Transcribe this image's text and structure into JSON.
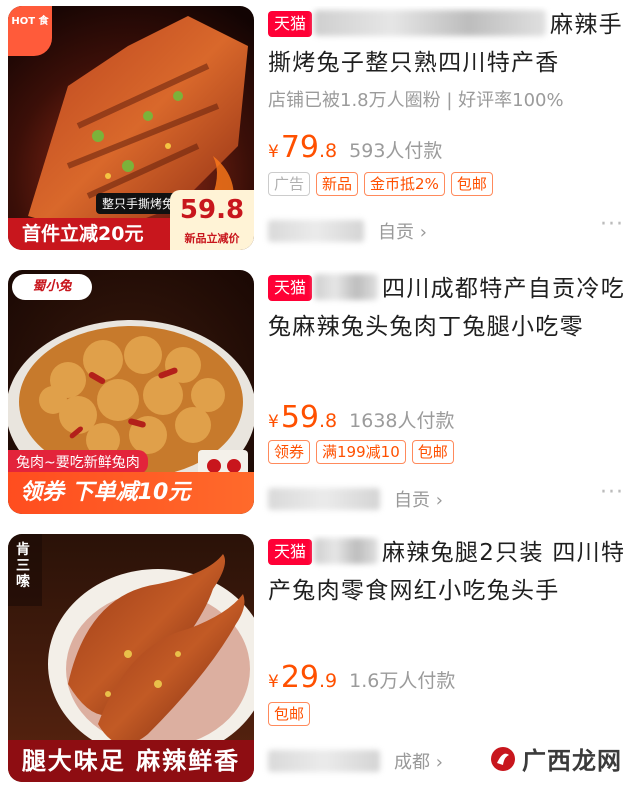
{
  "products": [
    {
      "tmall_badge": "天猫",
      "title_rest": "麻辣手撕烤兔子整只熟四川特产香",
      "subline": "店铺已被1.8万人圈粉 | 好评率100%",
      "currency": "¥",
      "price_int": "79",
      "price_dec": ".8",
      "paid_count": "593人付款",
      "tags": [
        "广告",
        "新品",
        "金币抵2%",
        "包邮"
      ],
      "shop_location": "自贡 ›",
      "more": "···",
      "image": {
        "logo_text": "HOT 食",
        "product_label": "整只手撕烤兔",
        "banner_text": "首件立减20元",
        "banner_price": "59.8",
        "banner_price_sub": "新品立减价"
      }
    },
    {
      "tmall_badge": "天猫",
      "title_rest": "四川成都特产自贡冷吃兔麻辣兔头兔肉丁兔腿小吃零",
      "currency": "¥",
      "price_int": "59",
      "price_dec": ".8",
      "paid_count": "1638人付款",
      "tags": [
        "领券",
        "满199减10",
        "包邮"
      ],
      "shop_location": "自贡 ›",
      "more": "···",
      "image": {
        "logo_text": "蜀小兔",
        "top_label": "兔肉~要吃新鲜兔肉",
        "banner_text": "领券 下单减10元"
      }
    },
    {
      "tmall_badge": "天猫",
      "title_rest": "麻辣兔腿2只装 四川特产兔肉零食网红小吃兔头手",
      "currency": "¥",
      "price_int": "29",
      "price_dec": ".9",
      "paid_count": "1.6万人付款",
      "tags": [
        "包邮"
      ],
      "shop_location": "成都 ›",
      "more": "···",
      "image": {
        "logo_text": "肯三嗦",
        "banner_text": "腿大味足 麻辣鲜香"
      }
    }
  ],
  "watermark": {
    "text": "广西龙网"
  },
  "colors": {
    "tmall": "#ff0036",
    "price": "#ff5000",
    "tag_border": "#ff8a5c"
  }
}
